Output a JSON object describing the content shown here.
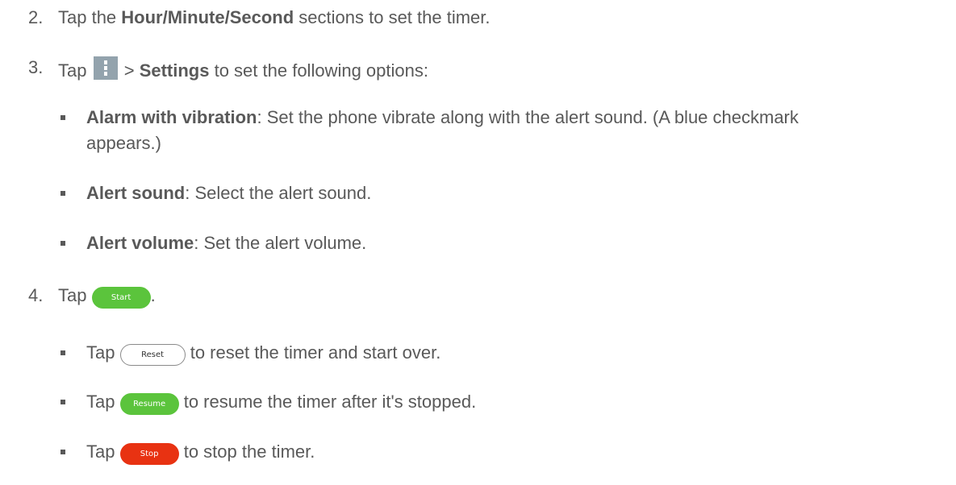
{
  "steps": [
    {
      "number": "2.",
      "prefix": "Tap the ",
      "bold": "Hour/Minute/Second",
      "suffix": " sections to set the timer."
    },
    {
      "number": "3.",
      "prefix": "Tap",
      "separator": " > ",
      "bold": "Settings",
      "suffix": " to set the following options:",
      "icon": "more-options-icon"
    },
    {
      "number": "4.",
      "prefix": "Tap",
      "button_label": "Start",
      "suffix": "."
    }
  ],
  "options": [
    {
      "bold": "Alarm with vibration",
      "text": ": Set the phone vibrate along with the alert sound. (A blue checkmark",
      "continuation": "appears.)"
    },
    {
      "bold": "Alert sound",
      "text": ": Select the alert sound."
    },
    {
      "bold": "Alert volume",
      "text": ": Set the alert volume."
    }
  ],
  "substeps": [
    {
      "prefix": "Tap",
      "button_label": "Reset",
      "suffix": " to reset the timer and start over."
    },
    {
      "prefix": "Tap",
      "button_label": "Resume",
      "suffix": " to resume the timer after it's stopped."
    },
    {
      "prefix": "Tap",
      "button_label": "Stop",
      "suffix": " to stop the timer."
    }
  ],
  "colors": {
    "text": "#595959",
    "start_button": "#5bc43c",
    "resume_button": "#5bc43c",
    "stop_button": "#e83212",
    "menu_icon": "#93a3ad"
  }
}
